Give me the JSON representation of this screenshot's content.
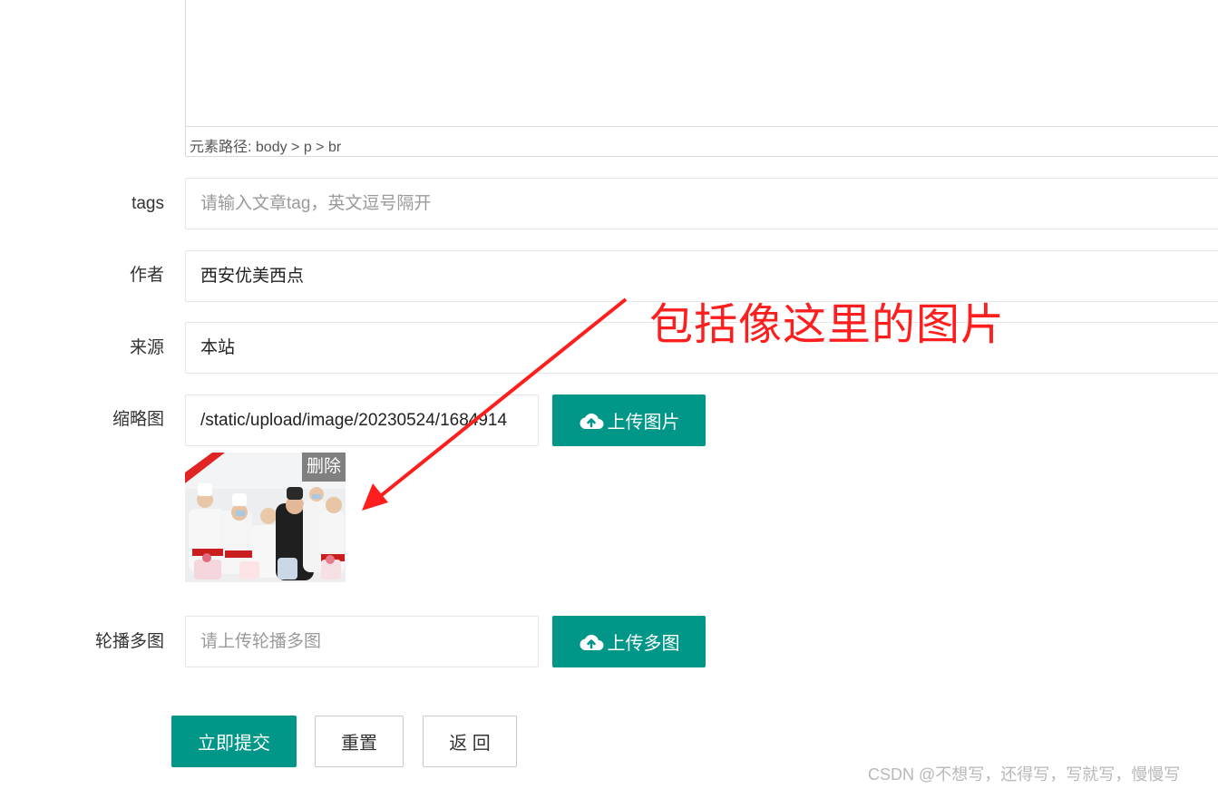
{
  "editor": {
    "path_text": "元素路径: body > p > br"
  },
  "form": {
    "tags": {
      "label": "tags",
      "placeholder": "请输入文章tag，英文逗号隔开"
    },
    "author": {
      "label": "作者",
      "value": "西安优美西点"
    },
    "source": {
      "label": "来源",
      "value": "本站"
    },
    "thumbnail": {
      "label": "缩略图",
      "value": "/static/upload/image/20230524/1684914",
      "upload_label": "上传图片",
      "delete_label": "删除"
    },
    "carousel": {
      "label": "轮播多图",
      "placeholder": "请上传轮播多图",
      "upload_label": "上传多图"
    }
  },
  "actions": {
    "submit": "立即提交",
    "reset": "重置",
    "back": "返 回"
  },
  "annotation": {
    "text": "包括像这里的图片",
    "color": "#ff1e1e"
  },
  "watermark": "CSDN @不想写，还得写，写就写，慢慢写",
  "colors": {
    "primary": "#009688"
  },
  "icons": {
    "upload": "cloud-upload-icon"
  }
}
